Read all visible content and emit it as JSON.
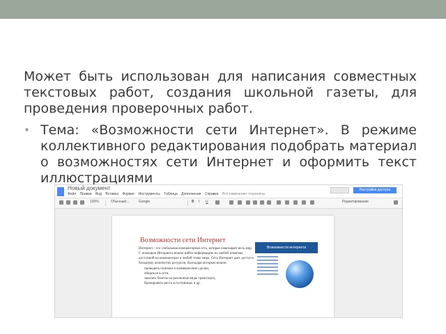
{
  "slide": {
    "paragraph": "Может быть использован для написания совместных текстовых работ, создания школьной газеты, для проведения проверочных работ.",
    "bullet": "Тема: «Возможности сети Интернет». В режиме коллективного редактирования подобрать материал о возможностях сети Интернет и оформить текст иллюстрациями"
  },
  "docs": {
    "title": "Новый документ",
    "menu": [
      "Файл",
      "Правка",
      "Вид",
      "Вставка",
      "Формат",
      "Инструменты",
      "Таблица",
      "Дополнения",
      "Справка",
      "Все изменения сохранены"
    ],
    "toolbar": {
      "zoom": "100%",
      "style": "Обычный...",
      "font": "Google",
      "mode": "Редактирование"
    },
    "share_label": "Настройки доступа",
    "heading": "Возможности сети Интернет",
    "body_para": "Интернет - это глобальная компьютерная сеть, которая охватывает весь мир. С помощью Интернета можно найти информацию по любой тематике, доступной на компьютерах в любой точке мира. Сеть Интернет дает доступ к большому количеству ресурсов, благодаря которым можно:",
    "body_items": [
      "проводить платежи и коммерческие сделки,",
      "общаться в сети,",
      "заказать билеты на различные виды транспорта,",
      "бронировать места в гостиницах и др."
    ],
    "image_caption": "Возможности интернета"
  },
  "colors": {
    "top_bar": "#9aa79a",
    "bullet": "#8fa38e",
    "docs_blue": "#4a8af4",
    "heading_red": "#c0392b"
  },
  "icons": [
    "bullet-icon",
    "docs-logo-icon",
    "globe-icon"
  ]
}
